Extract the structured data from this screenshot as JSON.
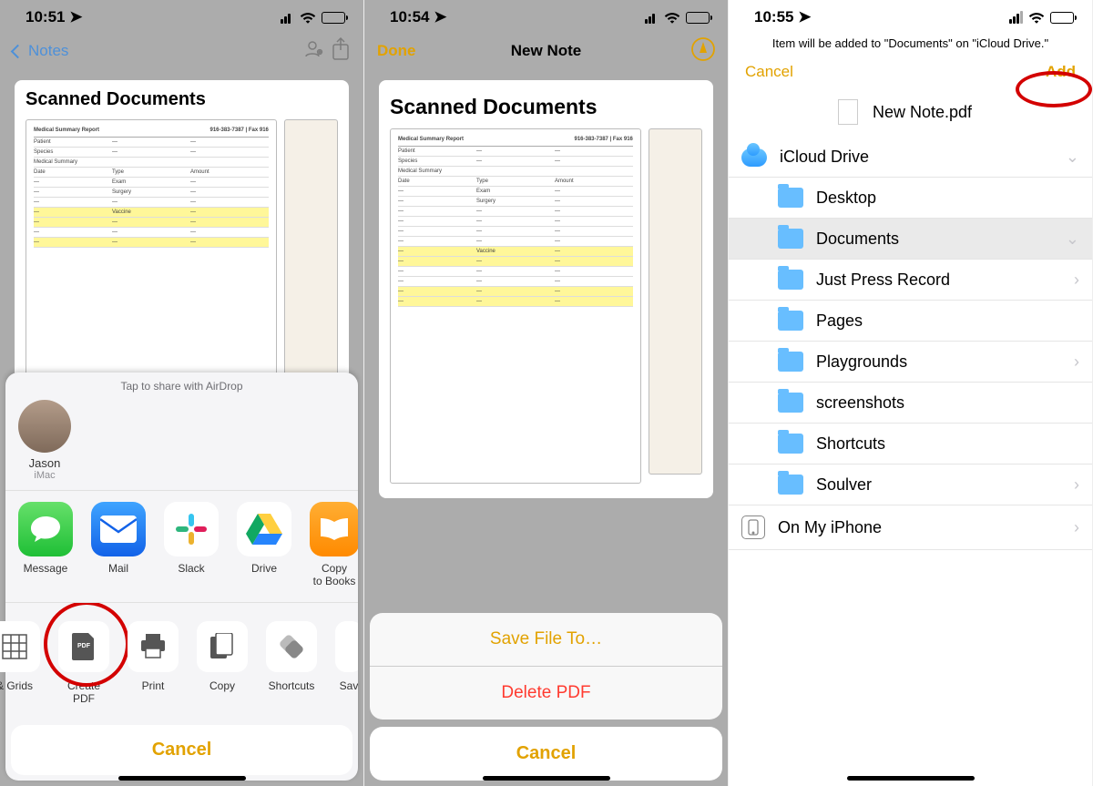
{
  "screen1": {
    "time": "10:51",
    "back": "Notes",
    "doc_title": "Scanned Documents",
    "sheet_hint": "Tap to share with AirDrop",
    "contact_name": "Jason",
    "contact_device": "iMac",
    "apps": [
      "Message",
      "Mail",
      "Slack",
      "Drive",
      "Copy\nto Books"
    ],
    "actions": [
      "& Grids",
      "Create PDF",
      "Print",
      "Copy",
      "Shortcuts",
      "Sav"
    ],
    "cancel": "Cancel"
  },
  "screen2": {
    "time": "10:54",
    "done": "Done",
    "title": "New Note",
    "doc_title": "Scanned Documents",
    "save": "Save File To…",
    "delete": "Delete PDF",
    "cancel": "Cancel"
  },
  "screen3": {
    "time": "10:55",
    "msg": "Item will be added to \"Documents\" on \"iCloud Drive.\"",
    "cancel": "Cancel",
    "add": "Add",
    "filename": "New Note.pdf",
    "icloud": "iCloud Drive",
    "folders": [
      "Desktop",
      "Documents",
      "Just Press Record",
      "Pages",
      "Playgrounds",
      "screenshots",
      "Shortcuts",
      "Soulver"
    ],
    "onmyiphone": "On My iPhone"
  }
}
